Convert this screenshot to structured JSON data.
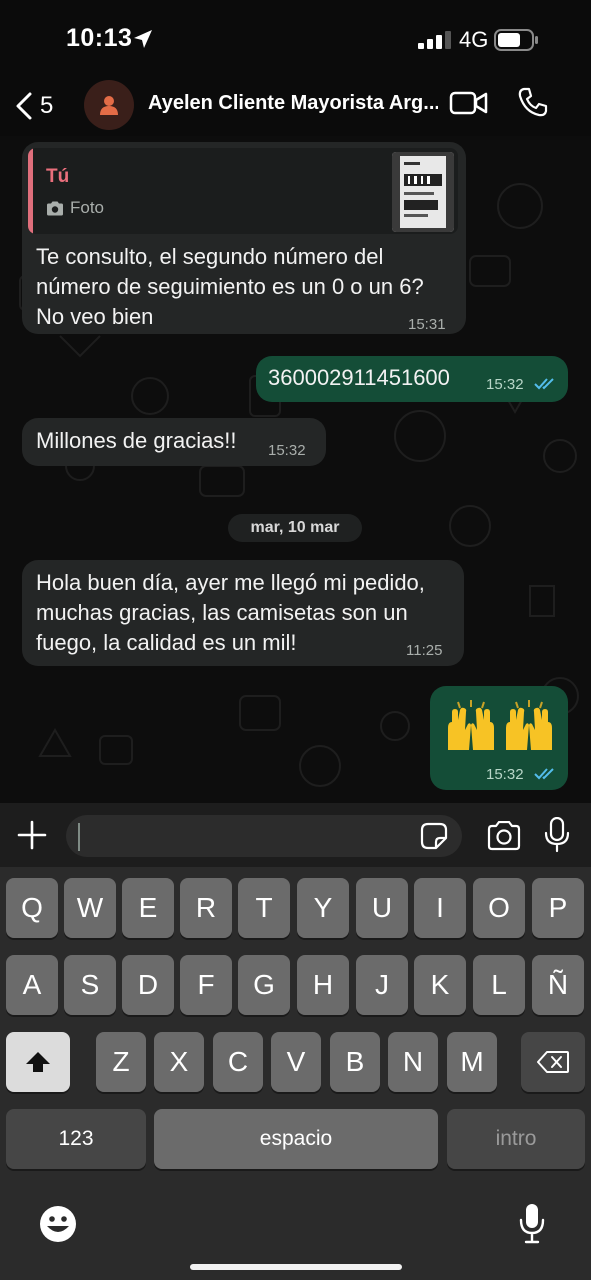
{
  "status_bar": {
    "time": "10:13",
    "network": "4G"
  },
  "header": {
    "back_count": "5",
    "contact_name": "Ayelen Cliente Mayorista Arg..."
  },
  "messages": [
    {
      "direction": "in",
      "quote_author": "Tú",
      "quote_type": "Foto",
      "text_lines": [
        "Te consulto, el segundo número del",
        "número de seguimiento es un 0 o un 6?",
        "No veo bien"
      ],
      "time": "15:31"
    },
    {
      "direction": "out",
      "text": "360002911451600",
      "time": "15:32"
    },
    {
      "direction": "in",
      "text": "Millones de gracias!!",
      "time": "15:32"
    },
    {
      "direction": "in",
      "text_lines": [
        "Hola buen día, ayer me llegó mi pedido,",
        "muchas gracias, las camisetas son un",
        "fuego, la calidad es un mil!"
      ],
      "time": "11:25"
    },
    {
      "direction": "out",
      "emoji": "🙌🙌",
      "time": "15:32"
    }
  ],
  "date_separator": "mar, 10 mar",
  "compose": {
    "value": "",
    "placeholder": ""
  },
  "keyboard": {
    "row1": [
      "Q",
      "W",
      "E",
      "R",
      "T",
      "Y",
      "U",
      "I",
      "O",
      "P"
    ],
    "row2": [
      "A",
      "S",
      "D",
      "F",
      "G",
      "H",
      "J",
      "K",
      "L",
      "Ñ"
    ],
    "row3": [
      "Z",
      "X",
      "C",
      "V",
      "B",
      "N",
      "M"
    ],
    "numbers_key": "123",
    "space_key": "espacio",
    "return_key": "intro"
  },
  "colors": {
    "incoming_bubble": "#242626",
    "outgoing_bubble": "#144d37",
    "read_ticks": "#53bdeb",
    "quote_accent": "#e96f7c"
  }
}
